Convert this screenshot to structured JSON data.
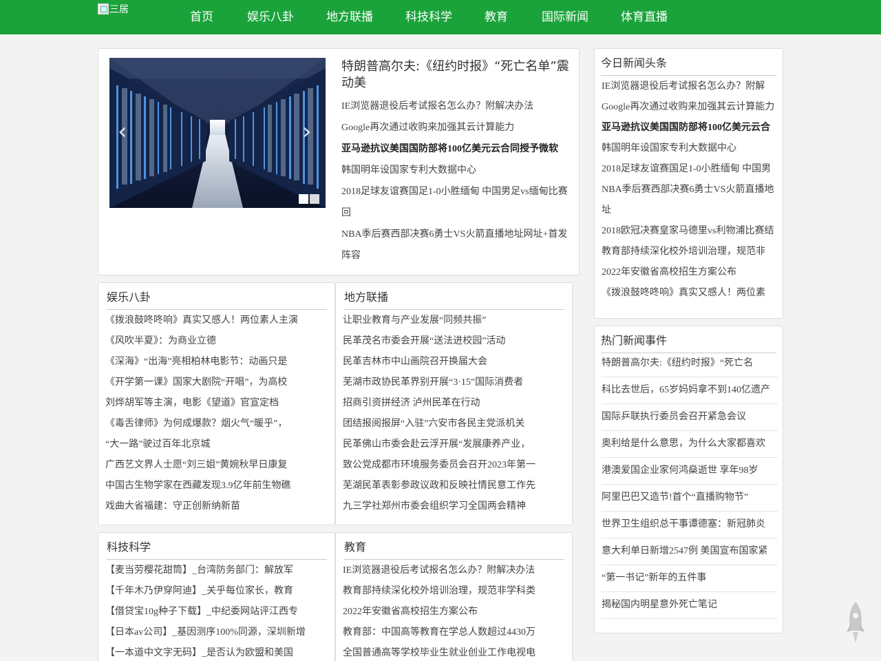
{
  "header": {
    "logo_alt": "三居",
    "nav": [
      "首页",
      "娱乐八卦",
      "地方联播",
      "科技科学",
      "教育",
      "国际新闻",
      "体育直播"
    ]
  },
  "featured": {
    "title": "特朗普高尔夫:《纽约时报》“死亡名单”震动美",
    "items": [
      {
        "text": "IE浏览器退役后考试报名怎么办？附解决办法",
        "bold": false
      },
      {
        "text": "Google再次通过收购来加强其云计算能力",
        "bold": false
      },
      {
        "text": "亚马逊抗议美国国防部将100亿美元云合同授予微软",
        "bold": true
      },
      {
        "text": "韩国明年设国家专利大数据中心",
        "bold": false
      },
      {
        "text": "2018足球友谊赛国足1-0小胜缅甸 中国男足vs缅甸比赛回",
        "bold": false
      },
      {
        "text": "NBA季后赛西部决赛6勇士VS火箭直播地址网址+首发阵容",
        "bold": false
      }
    ],
    "slider": {
      "prev_icon": "‹",
      "next_icon": "›",
      "slides": 2,
      "active": 1
    }
  },
  "sections": {
    "entertainment": {
      "title": "娱乐八卦",
      "items": [
        "《拨浪鼓咚咚响》真实又感人！两位素人主演",
        "《风吹半夏》：为商业立德",
        "《深海》“出海”亮相柏林电影节：动画只是",
        "《开学第一课》国家大剧院“开唱”，为高校",
        "刘烨胡军等主演，电影《望道》官宣定档",
        "《毒舌律师》为何成爆款？烟火气“暖乎”，",
        "“大一路”驶过百年北京城",
        "广西艺文界人士愿“刘三姐”黄婉秋早日康复",
        "中国古生物学家在西藏发现3.9亿年前生物礁",
        "戏曲大省福建：守正创新纳新苗"
      ]
    },
    "local": {
      "title": "地方联播",
      "items": [
        "让职业教育与产业发展“同频共振”",
        "民革茂名市委会开展“送法进校园”活动",
        "民革吉林市中山画院召开换届大会",
        "芜湖市政协民革界别开展“3·15”国际消费者",
        "招商引资拼经济 泸州民革在行动",
        "团结报阅报屏“入驻”六安市各民主党派机关",
        "民革佛山市委会赴云浮开展“发展康养产业，",
        "致公党成都市环境服务委员会召开2023年第一",
        "芜湖民革表彰参政议政和反映社情民意工作先",
        "九三学社郑州市委会组织学习全国两会精神"
      ]
    },
    "tech": {
      "title": "科技科学",
      "items": [
        "【麦当劳樱花甜筒】_台湾防务部门：解放军",
        "【千年木乃伊穿阿迪】_关乎每位家长，教育",
        "【借贷宝10g种子下载】_中纪委网站评江西专",
        "【日本av公司】_基因测序100%同源，深圳新增",
        "【一本道中文字无码】_是否认为欧盟和美国"
      ]
    },
    "education": {
      "title": "教育",
      "items": [
        "IE浏览器退役后考试报名怎么办？附解决办法",
        "教育部持续深化校外培训治理，规范非学科类",
        "2022年安徽省高校招生方案公布",
        "教育部：中国高等教育在学总人数超过4430万",
        "全国普通高等学校毕业生就业创业工作电视电"
      ]
    }
  },
  "sidebar": {
    "headlines": {
      "title": "今日新闻头条",
      "items": [
        {
          "text": "IE浏览器退役后考试报名怎么办？附解",
          "bold": false
        },
        {
          "text": "Google再次通过收购来加强其云计算能力",
          "bold": false
        },
        {
          "text": "亚马逊抗议美国国防部将100亿美元云合",
          "bold": true
        },
        {
          "text": "韩国明年设国家专利大数据中心",
          "bold": false
        },
        {
          "text": "2018足球友谊赛国足1-0小胜缅甸 中国男",
          "bold": false
        },
        {
          "text": "NBA季后赛西部决赛6勇士VS火箭直播地",
          "bold": false
        },
        {
          "text": "址",
          "bold": false
        },
        {
          "text": "2018欧冠决赛皇家马德里vs利物浦比赛结",
          "bold": false
        },
        {
          "text": "教育部持续深化校外培训治理，规范非",
          "bold": false
        },
        {
          "text": "2022年安徽省高校招生方案公布",
          "bold": false
        },
        {
          "text": "《拨浪鼓咚咚响》真实又感人！两位素",
          "bold": false
        }
      ]
    },
    "hot": {
      "title": "热门新闻事件",
      "items": [
        "特朗普高尔夫:《纽约时报》“死亡名",
        "科比去世后，65岁妈妈拿不到140亿遗产",
        "国际乒联执行委员会召开紧急会议",
        "奥利给是什么意思，为什么大家都喜欢",
        "港澳爱国企业家何鸿燊逝世 享年98岁",
        "阿里巴巴又造节!首个“直播购物节”",
        "世界卫生组织总干事谭德塞：新冠肺炎",
        "意大利单日新增2547例 美国宣布国家紧",
        "“第一书记”新年的五件事",
        "揭秘国内明星意外死亡笔记"
      ]
    }
  },
  "widgets": {
    "back_to_top_icon": "rocket-icon"
  },
  "colors": {
    "header_bg": "#1aa33a",
    "page_bg": "#f3f3f3"
  }
}
